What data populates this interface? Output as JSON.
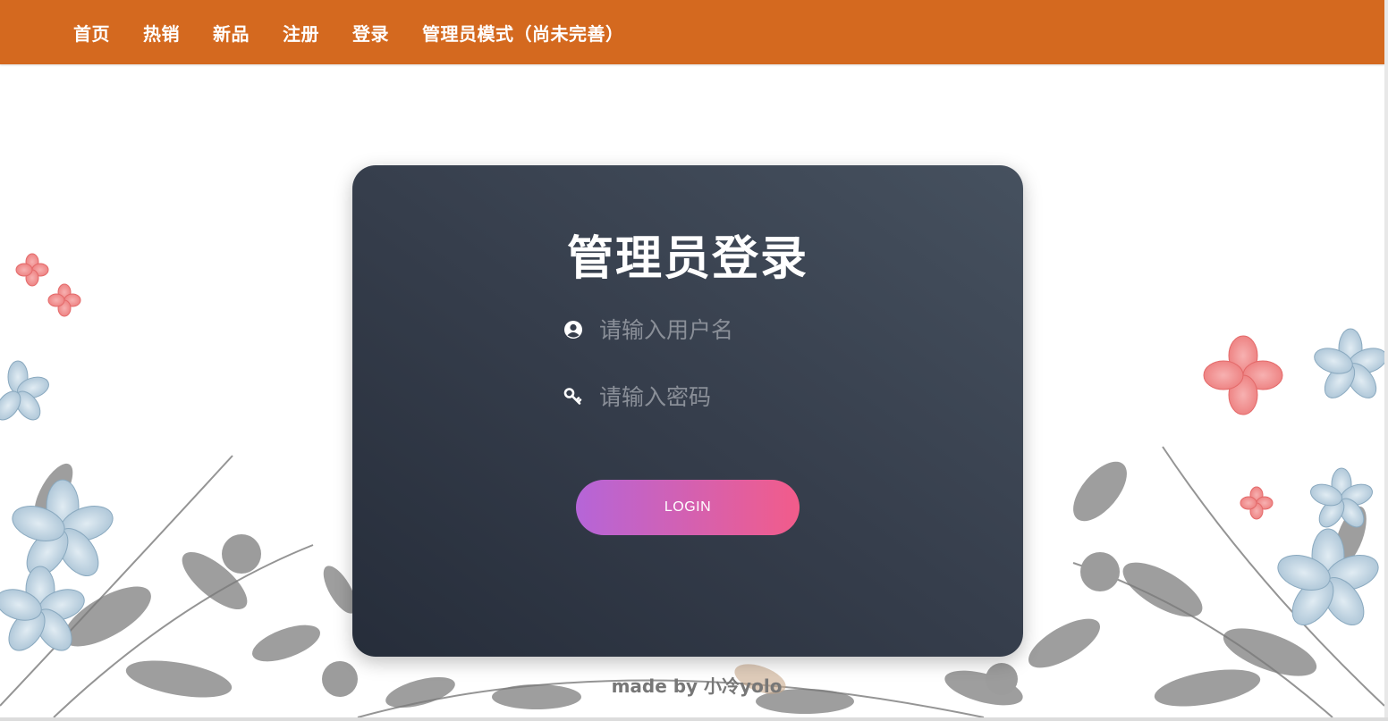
{
  "nav": {
    "items": [
      {
        "label": "首页"
      },
      {
        "label": "热销"
      },
      {
        "label": "新品"
      },
      {
        "label": "注册"
      },
      {
        "label": "登录"
      },
      {
        "label": "管理员模式（尚未完善）"
      }
    ]
  },
  "login": {
    "title": "管理员登录",
    "username_placeholder": "请输入用户名",
    "password_placeholder": "请输入密码",
    "button_label": "LOGIN"
  },
  "footer": {
    "credit": "made by 小冷yolo"
  },
  "colors": {
    "nav_background": "#d4691f",
    "card_gradient_start": "#262d3a",
    "card_gradient_end": "#46515f",
    "button_gradient_start": "#b565d8",
    "button_gradient_end": "#f25c8a"
  },
  "icons": {
    "username": "user-circle-icon",
    "password": "key-icon"
  }
}
